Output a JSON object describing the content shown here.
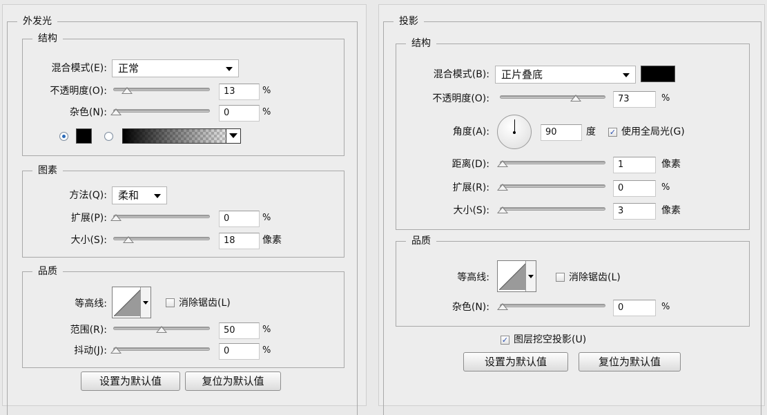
{
  "outer_glow": {
    "title": "外发光",
    "structure": {
      "title": "结构",
      "blend_mode_label": "混合模式(E):",
      "blend_mode_value": "正常",
      "opacity_label": "不透明度(O):",
      "opacity_value": "13",
      "opacity_unit": "%",
      "noise_label": "杂色(N):",
      "noise_value": "0",
      "noise_unit": "%",
      "color": "#000000"
    },
    "elements": {
      "title": "图素",
      "technique_label": "方法(Q):",
      "technique_value": "柔和",
      "spread_label": "扩展(P):",
      "spread_value": "0",
      "spread_unit": "%",
      "size_label": "大小(S):",
      "size_value": "18",
      "size_unit": "像素"
    },
    "quality": {
      "title": "品质",
      "contour_label": "等高线:",
      "anti_alias_label": "消除锯齿(L)",
      "anti_alias_checked": false,
      "range_label": "范围(R):",
      "range_value": "50",
      "range_unit": "%",
      "jitter_label": "抖动(J):",
      "jitter_value": "0",
      "jitter_unit": "%"
    },
    "buttons": {
      "make_default": "设置为默认值",
      "reset_default": "复位为默认值"
    }
  },
  "drop_shadow": {
    "title": "投影",
    "structure": {
      "title": "结构",
      "blend_mode_label": "混合模式(B):",
      "blend_mode_value": "正片叠底",
      "color": "#000000",
      "opacity_label": "不透明度(O):",
      "opacity_value": "73",
      "opacity_unit": "%",
      "angle_label": "角度(A):",
      "angle_value": "90",
      "angle_unit": "度",
      "global_light_label": "使用全局光(G)",
      "global_light_checked": true,
      "distance_label": "距离(D):",
      "distance_value": "1",
      "distance_unit": "像素",
      "spread_label": "扩展(R):",
      "spread_value": "0",
      "spread_unit": "%",
      "size_label": "大小(S):",
      "size_value": "3",
      "size_unit": "像素"
    },
    "quality": {
      "title": "品质",
      "contour_label": "等高线:",
      "anti_alias_label": "消除锯齿(L)",
      "anti_alias_checked": false,
      "noise_label": "杂色(N):",
      "noise_value": "0",
      "noise_unit": "%"
    },
    "knockout_label": "图层挖空投影(U)",
    "knockout_checked": true,
    "buttons": {
      "make_default": "设置为默认值",
      "reset_default": "复位为默认值"
    }
  }
}
